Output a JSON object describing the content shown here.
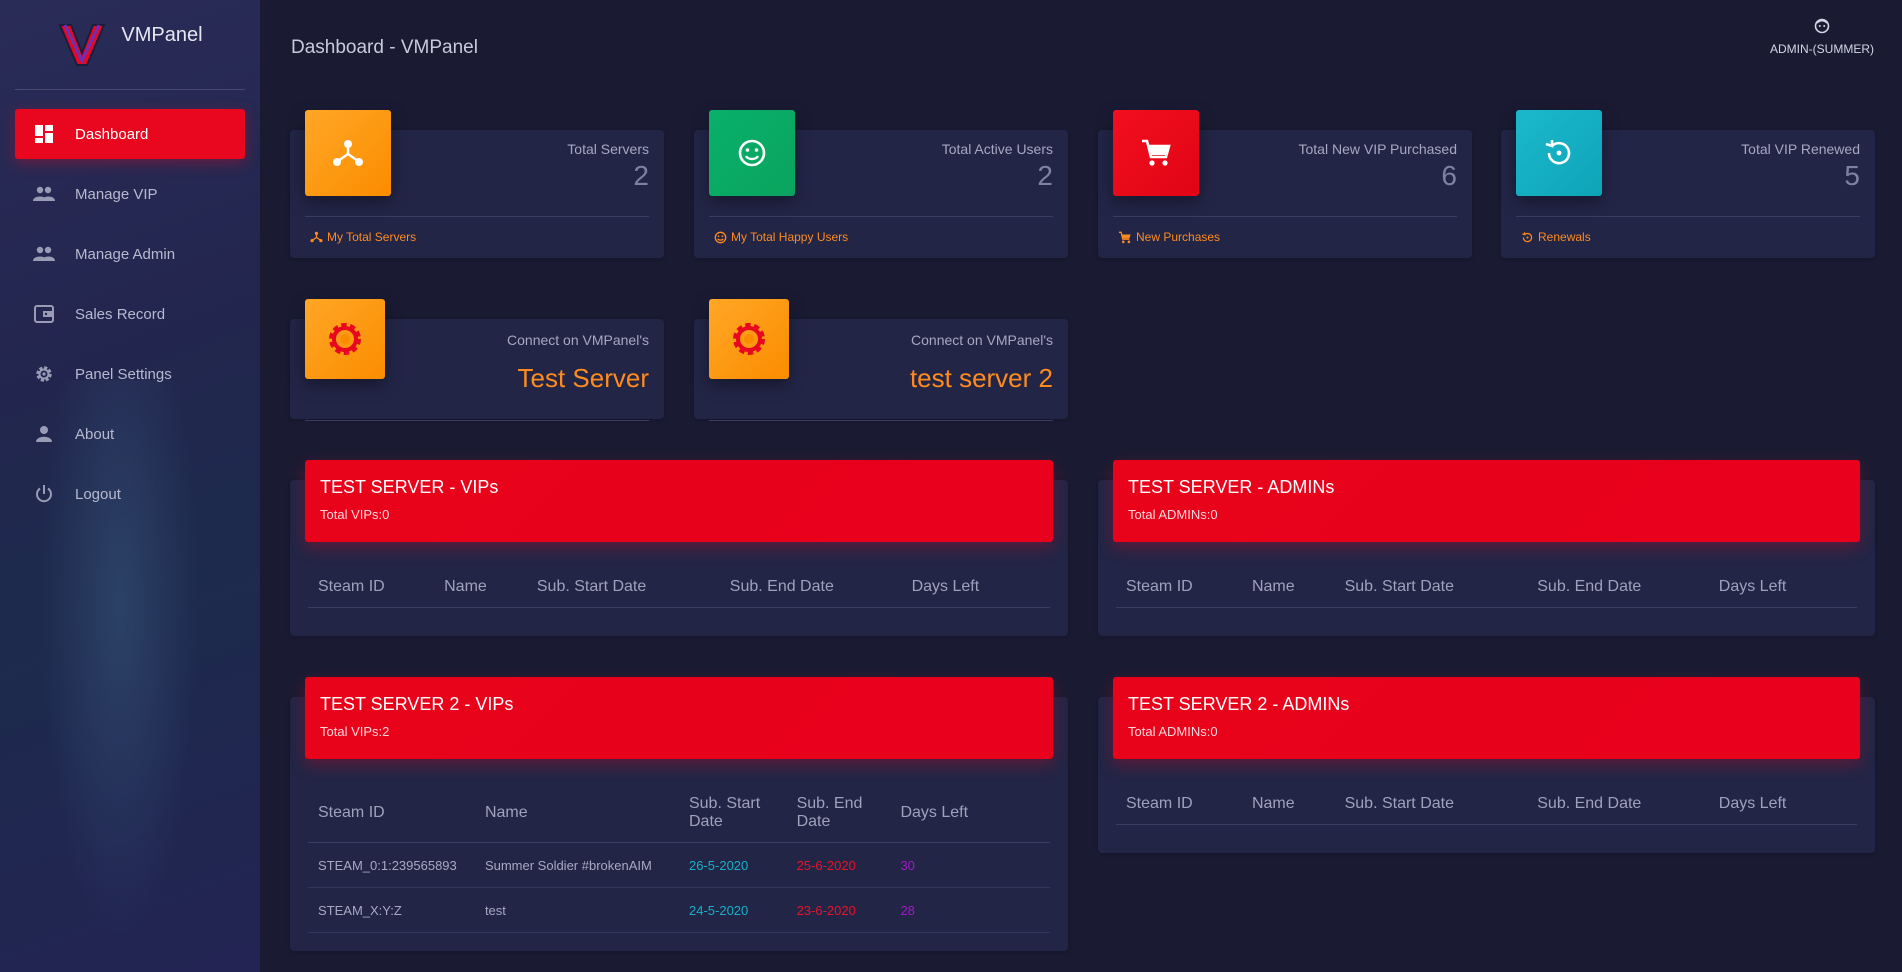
{
  "sidebar": {
    "brand": "VMPanel",
    "items": [
      {
        "label": "Dashboard",
        "icon": "dashboard-icon",
        "active": true
      },
      {
        "label": "Manage VIP",
        "icon": "people-icon"
      },
      {
        "label": "Manage Admin",
        "icon": "people-icon"
      },
      {
        "label": "Sales Record",
        "icon": "wallet-icon"
      },
      {
        "label": "Panel Settings",
        "icon": "gear-icon"
      },
      {
        "label": "About",
        "icon": "person-icon"
      },
      {
        "label": "Logout",
        "icon": "power-icon"
      }
    ]
  },
  "header": {
    "title": "Dashboard - VMPanel",
    "user": "ADMIN-(SUMMER)"
  },
  "stats": [
    {
      "label": "Total Servers",
      "value": "2",
      "footer": "My Total Servers",
      "color": "#fb8c00",
      "icon": "hub-icon"
    },
    {
      "label": "Total Active Users",
      "value": "2",
      "footer": "My Total Happy Users",
      "color": "#0aa45f",
      "icon": "smiley-icon"
    },
    {
      "label": "Total New VIP Purchased",
      "value": "6",
      "footer": "New Purchases",
      "color": "#e00414",
      "icon": "cart-icon"
    },
    {
      "label": "Total VIP Renewed",
      "value": "5",
      "footer": "Renewals",
      "color": "#0ea4b8",
      "icon": "renew-icon"
    }
  ],
  "servers": [
    {
      "label": "Connect on VMPanel's",
      "name": "Test Server"
    },
    {
      "label": "Connect on VMPanel's",
      "name": "test server 2"
    }
  ],
  "table_columns": [
    "Steam ID",
    "Name",
    "Sub. Start Date",
    "Sub. End Date",
    "Days Left"
  ],
  "panels": [
    {
      "title": "TEST SERVER - VIPs",
      "sub": "Total VIPs:0",
      "rows": []
    },
    {
      "title": "TEST SERVER - ADMINs",
      "sub": "Total ADMINs:0",
      "rows": []
    },
    {
      "title": "TEST SERVER 2 - VIPs",
      "sub": "Total VIPs:2",
      "rows": [
        {
          "steam_id": "STEAM_0:1:239565893",
          "name": "Summer Soldier #brokenAIM",
          "start": "26-5-2020",
          "end": "25-6-2020",
          "days": "30"
        },
        {
          "steam_id": "STEAM_X:Y:Z",
          "name": "test",
          "start": "24-5-2020",
          "end": "23-6-2020",
          "days": "28"
        }
      ]
    },
    {
      "title": "TEST SERVER 2 - ADMINs",
      "sub": "Total ADMINs:0",
      "rows": []
    }
  ]
}
